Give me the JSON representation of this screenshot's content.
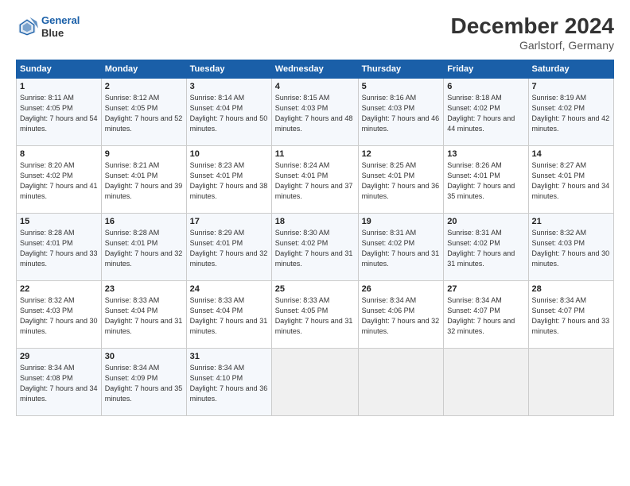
{
  "header": {
    "logo_line1": "General",
    "logo_line2": "Blue",
    "title": "December 2024",
    "subtitle": "Garlstorf, Germany"
  },
  "days_of_week": [
    "Sunday",
    "Monday",
    "Tuesday",
    "Wednesday",
    "Thursday",
    "Friday",
    "Saturday"
  ],
  "weeks": [
    [
      {
        "day": "1",
        "sunrise": "Sunrise: 8:11 AM",
        "sunset": "Sunset: 4:05 PM",
        "daylight": "Daylight: 7 hours and 54 minutes."
      },
      {
        "day": "2",
        "sunrise": "Sunrise: 8:12 AM",
        "sunset": "Sunset: 4:05 PM",
        "daylight": "Daylight: 7 hours and 52 minutes."
      },
      {
        "day": "3",
        "sunrise": "Sunrise: 8:14 AM",
        "sunset": "Sunset: 4:04 PM",
        "daylight": "Daylight: 7 hours and 50 minutes."
      },
      {
        "day": "4",
        "sunrise": "Sunrise: 8:15 AM",
        "sunset": "Sunset: 4:03 PM",
        "daylight": "Daylight: 7 hours and 48 minutes."
      },
      {
        "day": "5",
        "sunrise": "Sunrise: 8:16 AM",
        "sunset": "Sunset: 4:03 PM",
        "daylight": "Daylight: 7 hours and 46 minutes."
      },
      {
        "day": "6",
        "sunrise": "Sunrise: 8:18 AM",
        "sunset": "Sunset: 4:02 PM",
        "daylight": "Daylight: 7 hours and 44 minutes."
      },
      {
        "day": "7",
        "sunrise": "Sunrise: 8:19 AM",
        "sunset": "Sunset: 4:02 PM",
        "daylight": "Daylight: 7 hours and 42 minutes."
      }
    ],
    [
      {
        "day": "8",
        "sunrise": "Sunrise: 8:20 AM",
        "sunset": "Sunset: 4:02 PM",
        "daylight": "Daylight: 7 hours and 41 minutes."
      },
      {
        "day": "9",
        "sunrise": "Sunrise: 8:21 AM",
        "sunset": "Sunset: 4:01 PM",
        "daylight": "Daylight: 7 hours and 39 minutes."
      },
      {
        "day": "10",
        "sunrise": "Sunrise: 8:23 AM",
        "sunset": "Sunset: 4:01 PM",
        "daylight": "Daylight: 7 hours and 38 minutes."
      },
      {
        "day": "11",
        "sunrise": "Sunrise: 8:24 AM",
        "sunset": "Sunset: 4:01 PM",
        "daylight": "Daylight: 7 hours and 37 minutes."
      },
      {
        "day": "12",
        "sunrise": "Sunrise: 8:25 AM",
        "sunset": "Sunset: 4:01 PM",
        "daylight": "Daylight: 7 hours and 36 minutes."
      },
      {
        "day": "13",
        "sunrise": "Sunrise: 8:26 AM",
        "sunset": "Sunset: 4:01 PM",
        "daylight": "Daylight: 7 hours and 35 minutes."
      },
      {
        "day": "14",
        "sunrise": "Sunrise: 8:27 AM",
        "sunset": "Sunset: 4:01 PM",
        "daylight": "Daylight: 7 hours and 34 minutes."
      }
    ],
    [
      {
        "day": "15",
        "sunrise": "Sunrise: 8:28 AM",
        "sunset": "Sunset: 4:01 PM",
        "daylight": "Daylight: 7 hours and 33 minutes."
      },
      {
        "day": "16",
        "sunrise": "Sunrise: 8:28 AM",
        "sunset": "Sunset: 4:01 PM",
        "daylight": "Daylight: 7 hours and 32 minutes."
      },
      {
        "day": "17",
        "sunrise": "Sunrise: 8:29 AM",
        "sunset": "Sunset: 4:01 PM",
        "daylight": "Daylight: 7 hours and 32 minutes."
      },
      {
        "day": "18",
        "sunrise": "Sunrise: 8:30 AM",
        "sunset": "Sunset: 4:02 PM",
        "daylight": "Daylight: 7 hours and 31 minutes."
      },
      {
        "day": "19",
        "sunrise": "Sunrise: 8:31 AM",
        "sunset": "Sunset: 4:02 PM",
        "daylight": "Daylight: 7 hours and 31 minutes."
      },
      {
        "day": "20",
        "sunrise": "Sunrise: 8:31 AM",
        "sunset": "Sunset: 4:02 PM",
        "daylight": "Daylight: 7 hours and 31 minutes."
      },
      {
        "day": "21",
        "sunrise": "Sunrise: 8:32 AM",
        "sunset": "Sunset: 4:03 PM",
        "daylight": "Daylight: 7 hours and 30 minutes."
      }
    ],
    [
      {
        "day": "22",
        "sunrise": "Sunrise: 8:32 AM",
        "sunset": "Sunset: 4:03 PM",
        "daylight": "Daylight: 7 hours and 30 minutes."
      },
      {
        "day": "23",
        "sunrise": "Sunrise: 8:33 AM",
        "sunset": "Sunset: 4:04 PM",
        "daylight": "Daylight: 7 hours and 31 minutes."
      },
      {
        "day": "24",
        "sunrise": "Sunrise: 8:33 AM",
        "sunset": "Sunset: 4:04 PM",
        "daylight": "Daylight: 7 hours and 31 minutes."
      },
      {
        "day": "25",
        "sunrise": "Sunrise: 8:33 AM",
        "sunset": "Sunset: 4:05 PM",
        "daylight": "Daylight: 7 hours and 31 minutes."
      },
      {
        "day": "26",
        "sunrise": "Sunrise: 8:34 AM",
        "sunset": "Sunset: 4:06 PM",
        "daylight": "Daylight: 7 hours and 32 minutes."
      },
      {
        "day": "27",
        "sunrise": "Sunrise: 8:34 AM",
        "sunset": "Sunset: 4:07 PM",
        "daylight": "Daylight: 7 hours and 32 minutes."
      },
      {
        "day": "28",
        "sunrise": "Sunrise: 8:34 AM",
        "sunset": "Sunset: 4:07 PM",
        "daylight": "Daylight: 7 hours and 33 minutes."
      }
    ],
    [
      {
        "day": "29",
        "sunrise": "Sunrise: 8:34 AM",
        "sunset": "Sunset: 4:08 PM",
        "daylight": "Daylight: 7 hours and 34 minutes."
      },
      {
        "day": "30",
        "sunrise": "Sunrise: 8:34 AM",
        "sunset": "Sunset: 4:09 PM",
        "daylight": "Daylight: 7 hours and 35 minutes."
      },
      {
        "day": "31",
        "sunrise": "Sunrise: 8:34 AM",
        "sunset": "Sunset: 4:10 PM",
        "daylight": "Daylight: 7 hours and 36 minutes."
      },
      null,
      null,
      null,
      null
    ]
  ]
}
